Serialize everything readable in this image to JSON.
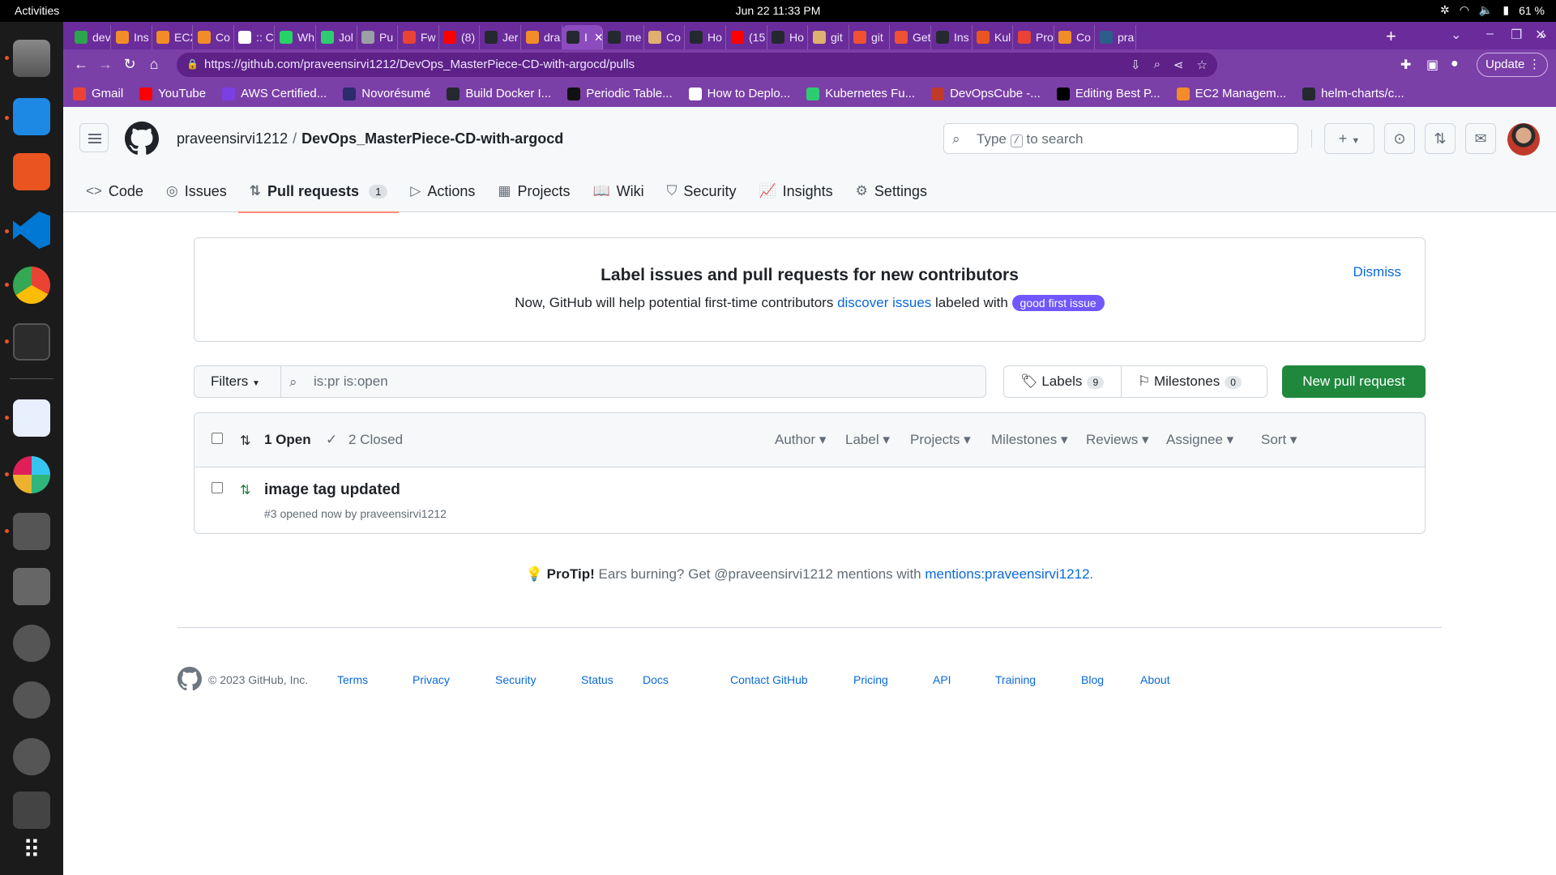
{
  "os": {
    "activities": "Activities",
    "clock": "Jun 22  11:33 PM",
    "battery": "61 %"
  },
  "browser": {
    "tabs": [
      {
        "label": "dev",
        "color": "#2da44e"
      },
      {
        "label": "Ins",
        "color": "#f28c28"
      },
      {
        "label": "EC2",
        "color": "#f28c28"
      },
      {
        "label": "Co",
        "color": "#f28c28"
      },
      {
        "label": ":: C",
        "color": "#ffffff"
      },
      {
        "label": "Wh",
        "color": "#25d366"
      },
      {
        "label": "Jol",
        "color": "#2ecc71"
      },
      {
        "label": "Pu",
        "color": "#9aa0a6"
      },
      {
        "label": "Fw",
        "color": "#ea4335"
      },
      {
        "label": "(8)",
        "color": "#ff0000"
      },
      {
        "label": "Jer",
        "color": "#24292f"
      },
      {
        "label": "dra",
        "color": "#f28c28"
      },
      {
        "label": "I",
        "color": "#24292f"
      },
      {
        "label": "me",
        "color": "#24292f"
      },
      {
        "label": "Co",
        "color": "#e0b070"
      },
      {
        "label": "Ho",
        "color": "#24292f"
      },
      {
        "label": "(15",
        "color": "#ff0000"
      },
      {
        "label": "Ho",
        "color": "#24292f"
      },
      {
        "label": "git",
        "color": "#e0b070"
      },
      {
        "label": "git",
        "color": "#f05133"
      },
      {
        "label": "Get",
        "color": "#f05133"
      },
      {
        "label": "Ins",
        "color": "#24292f"
      },
      {
        "label": "Kul",
        "color": "#e95420"
      },
      {
        "label": "Pro",
        "color": "#ea4335"
      },
      {
        "label": "Co",
        "color": "#f28c28"
      },
      {
        "label": "pra",
        "color": "#2d5d8a"
      }
    ],
    "active_tab_index": 12,
    "url": "https://github.com/praveensirvi1212/DevOps_MasterPiece-CD-with-argocd/pulls",
    "update_label": "Update",
    "bookmarks": [
      {
        "label": "Gmail",
        "color": "#ea4335"
      },
      {
        "label": "YouTube",
        "color": "#ff0000"
      },
      {
        "label": "AWS Certified...",
        "color": "#7b3fe4"
      },
      {
        "label": "Novorésumé",
        "color": "#2b2b6e"
      },
      {
        "label": "Build Docker I...",
        "color": "#24292f"
      },
      {
        "label": "Periodic Table...",
        "color": "#111111"
      },
      {
        "label": "How to Deplo...",
        "color": "#ffffff"
      },
      {
        "label": "Kubernetes Fu...",
        "color": "#2ecc71"
      },
      {
        "label": "DevOpsCube -...",
        "color": "#c0392b"
      },
      {
        "label": "Editing Best P...",
        "color": "#000000"
      },
      {
        "label": "EC2 Managem...",
        "color": "#f28c28"
      },
      {
        "label": "helm-charts/c...",
        "color": "#24292f"
      }
    ]
  },
  "github": {
    "owner": "praveensirvi1212",
    "repo": "DevOps_MasterPiece-CD-with-argocd",
    "search_placeholder_pre": "Type",
    "search_key": "/",
    "search_placeholder_post": "to search",
    "nav": [
      {
        "label": "Code",
        "icon": "<>"
      },
      {
        "label": "Issues",
        "icon": "◎"
      },
      {
        "label": "Pull requests",
        "icon": "⇅",
        "count": "1"
      },
      {
        "label": "Actions",
        "icon": "▷"
      },
      {
        "label": "Projects",
        "icon": "▦"
      },
      {
        "label": "Wiki",
        "icon": "📖"
      },
      {
        "label": "Security",
        "icon": "⛉"
      },
      {
        "label": "Insights",
        "icon": "📈"
      },
      {
        "label": "Settings",
        "icon": "⚙"
      }
    ],
    "banner": {
      "title": "Label issues and pull requests for new contributors",
      "text_pre": "Now, GitHub will help potential first-time contributors",
      "link": "discover issues",
      "text_post": "labeled with",
      "label": "good first issue",
      "dismiss": "Dismiss"
    },
    "filters": {
      "button": "Filters",
      "query": "is:pr is:open",
      "labels": "Labels",
      "labels_count": "9",
      "milestones": "Milestones",
      "milestones_count": "0",
      "new_pr": "New pull request"
    },
    "list_header": {
      "open": "1 Open",
      "closed": "2 Closed",
      "filters": [
        "Author",
        "Label",
        "Projects",
        "Milestones",
        "Reviews",
        "Assignee",
        "Sort"
      ]
    },
    "pulls": [
      {
        "title": "image tag updated",
        "meta": "#3 opened now by praveensirvi1212"
      }
    ],
    "protip": {
      "label": "ProTip!",
      "text": "Ears burning? Get @praveensirvi1212 mentions with",
      "link": "mentions:praveensirvi1212",
      "end": "."
    },
    "footer": {
      "copyright": "© 2023 GitHub, Inc.",
      "links": [
        "Terms",
        "Privacy",
        "Security",
        "Status",
        "Docs",
        "Contact GitHub",
        "Pricing",
        "API",
        "Training",
        "Blog",
        "About"
      ]
    }
  }
}
